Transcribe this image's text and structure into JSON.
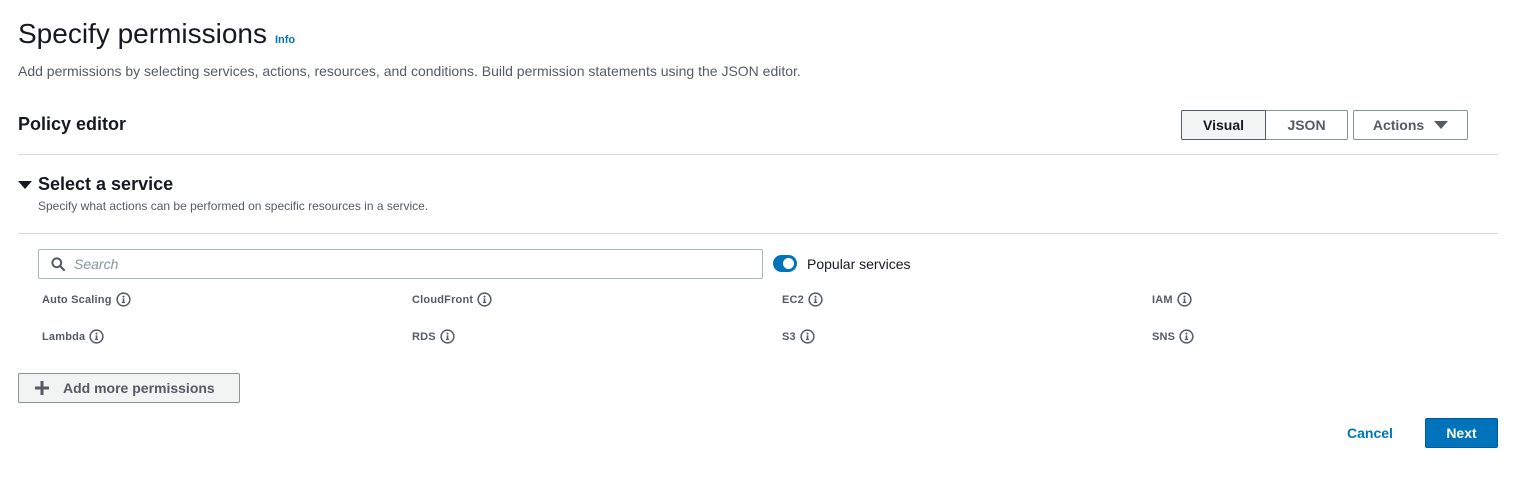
{
  "header": {
    "title": "Specify permissions",
    "info_label": "Info",
    "description": "Add permissions by selecting services, actions, resources, and conditions. Build permission statements using the JSON editor."
  },
  "policy_editor": {
    "title": "Policy editor",
    "visual_label": "Visual",
    "json_label": "JSON",
    "actions_label": "Actions",
    "selected_mode": "Visual"
  },
  "section": {
    "title": "Select a service",
    "description": "Specify what actions can be performed on specific resources in a service.",
    "search_placeholder": "Search",
    "search_value": "",
    "popular_label": "Popular services",
    "popular_enabled": true,
    "services": [
      "Auto Scaling",
      "CloudFront",
      "EC2",
      "IAM",
      "Lambda",
      "RDS",
      "S3",
      "SNS"
    ]
  },
  "footer": {
    "add_label": "Add more permissions",
    "cancel_label": "Cancel",
    "next_label": "Next"
  },
  "colors": {
    "accent": "#0073bb",
    "text": "#16191f",
    "muted": "#545b64",
    "border": "#879596",
    "divider": "#d5dbdb"
  }
}
